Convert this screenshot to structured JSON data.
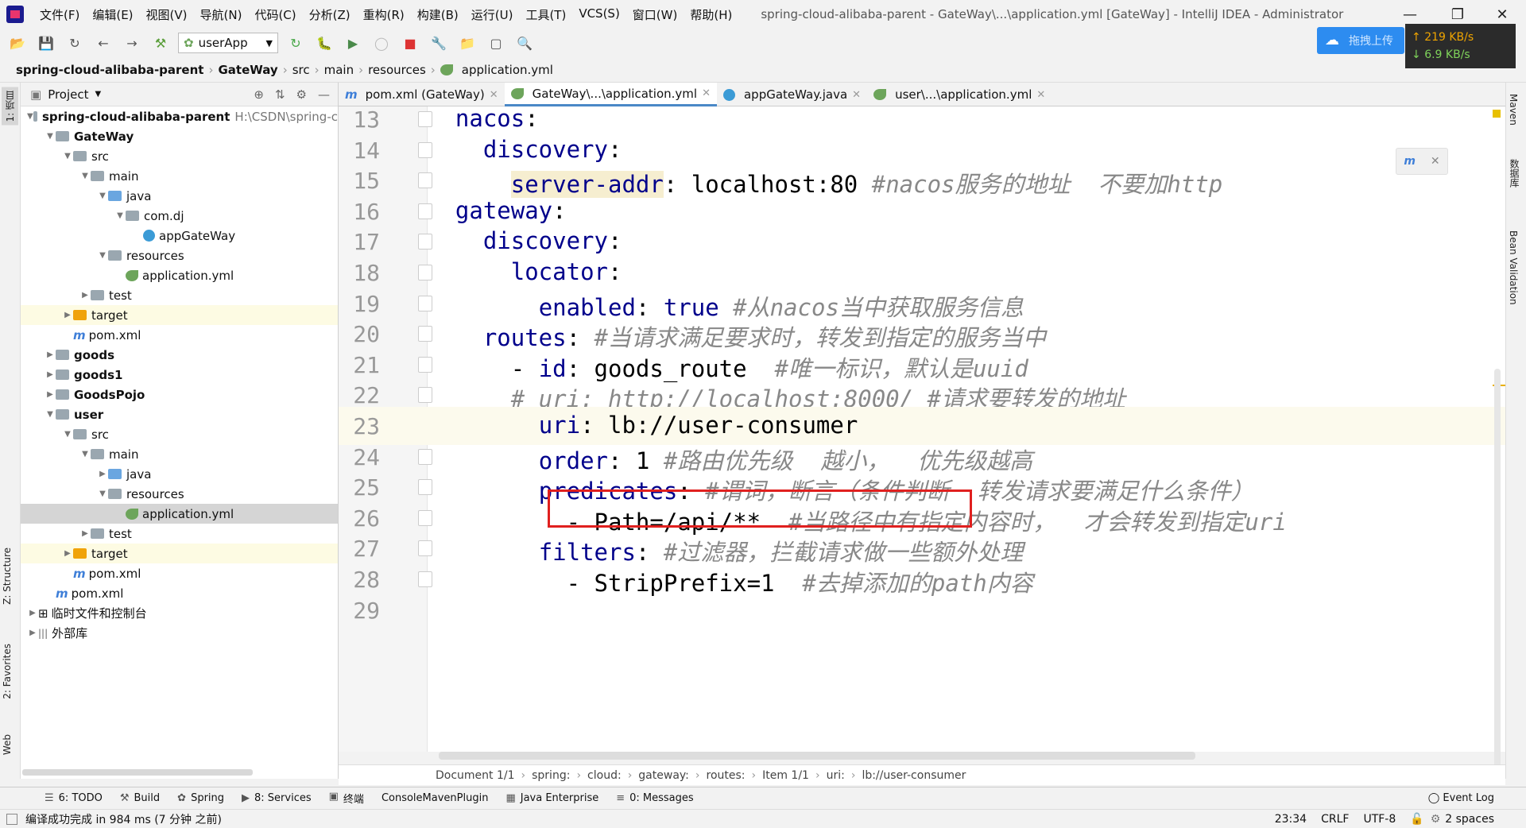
{
  "app": {
    "window_title": "spring-cloud-alibaba-parent - GateWay\\...\\application.yml [GateWay] - IntelliJ IDEA - Administrator",
    "menu": [
      "文件(F)",
      "编辑(E)",
      "视图(V)",
      "导航(N)",
      "代码(C)",
      "分析(Z)",
      "重构(R)",
      "构建(B)",
      "运行(U)",
      "工具(T)",
      "VCS(S)",
      "窗口(W)",
      "帮助(H)"
    ]
  },
  "toolbar": {
    "run_config": "userApp",
    "upload_label": "拖拽上传",
    "net_up": "219 KB/s",
    "net_down": "6.9 KB/s"
  },
  "breadcrumb": [
    "spring-cloud-alibaba-parent",
    "GateWay",
    "src",
    "main",
    "resources",
    "application.yml"
  ],
  "project": {
    "title": "Project",
    "root_path": "H:\\CSDN\\spring-c",
    "tree": [
      {
        "label": "spring-cloud-alibaba-parent",
        "depth": 0,
        "kind": "module",
        "bold": true,
        "open": true
      },
      {
        "label": "GateWay",
        "depth": 1,
        "kind": "module",
        "bold": true,
        "open": true
      },
      {
        "label": "src",
        "depth": 2,
        "kind": "folder",
        "open": true
      },
      {
        "label": "main",
        "depth": 3,
        "kind": "folder",
        "open": true
      },
      {
        "label": "java",
        "depth": 4,
        "kind": "blue",
        "open": true
      },
      {
        "label": "com.dj",
        "depth": 5,
        "kind": "folder",
        "open": true
      },
      {
        "label": "appGateWay",
        "depth": 6,
        "kind": "class"
      },
      {
        "label": "resources",
        "depth": 4,
        "kind": "res",
        "open": true
      },
      {
        "label": "application.yml",
        "depth": 5,
        "kind": "yml"
      },
      {
        "label": "test",
        "depth": 3,
        "kind": "folder",
        "open": false
      },
      {
        "label": "target",
        "depth": 2,
        "kind": "orange",
        "open": false,
        "hl": true
      },
      {
        "label": "pom.xml",
        "depth": 2,
        "kind": "maven"
      },
      {
        "label": "goods",
        "depth": 1,
        "kind": "module",
        "bold": true,
        "open": false
      },
      {
        "label": "goods1",
        "depth": 1,
        "kind": "module",
        "bold": true,
        "open": false
      },
      {
        "label": "GoodsPojo",
        "depth": 1,
        "kind": "module",
        "bold": true,
        "open": false
      },
      {
        "label": "user",
        "depth": 1,
        "kind": "module",
        "bold": true,
        "open": true
      },
      {
        "label": "src",
        "depth": 2,
        "kind": "folder",
        "open": true
      },
      {
        "label": "main",
        "depth": 3,
        "kind": "folder",
        "open": true
      },
      {
        "label": "java",
        "depth": 4,
        "kind": "blue",
        "open": false
      },
      {
        "label": "resources",
        "depth": 4,
        "kind": "res",
        "open": true
      },
      {
        "label": "application.yml",
        "depth": 5,
        "kind": "yml",
        "sel": true
      },
      {
        "label": "test",
        "depth": 3,
        "kind": "folder",
        "open": false
      },
      {
        "label": "target",
        "depth": 2,
        "kind": "orange",
        "open": false,
        "hl": true
      },
      {
        "label": "pom.xml",
        "depth": 2,
        "kind": "maven"
      },
      {
        "label": "pom.xml",
        "depth": 1,
        "kind": "maven"
      },
      {
        "label": "临时文件和控制台",
        "depth": 0,
        "kind": "scratch",
        "open": false
      },
      {
        "label": "外部库",
        "depth": 0,
        "kind": "lib",
        "open": false
      }
    ]
  },
  "tabs": [
    {
      "label": "pom.xml (GateWay)",
      "icon": "maven-icon"
    },
    {
      "label": "GateWay\\...\\application.yml",
      "icon": "yml-icon",
      "active": true
    },
    {
      "label": "appGateWay.java",
      "icon": "class-icon"
    },
    {
      "label": "user\\...\\application.yml",
      "icon": "yml-icon"
    }
  ],
  "editor": {
    "lines": [
      {
        "n": "13",
        "indent": "  ",
        "key": "nacos",
        "sep": ":",
        "val": "",
        "comment": ""
      },
      {
        "n": "14",
        "indent": "    ",
        "key": "discovery",
        "sep": ":",
        "val": "",
        "comment": ""
      },
      {
        "n": "15",
        "indent": "      ",
        "key": "server-addr",
        "sep": ":",
        "val": " localhost:80 ",
        "comment": "#nacos服务的地址  不要加http",
        "keyhl": true
      },
      {
        "n": "16",
        "indent": "  ",
        "key": "gateway",
        "sep": ":",
        "val": "",
        "comment": ""
      },
      {
        "n": "17",
        "indent": "    ",
        "key": "discovery",
        "sep": ":",
        "val": "",
        "comment": ""
      },
      {
        "n": "18",
        "indent": "      ",
        "key": "locator",
        "sep": ":",
        "val": "",
        "comment": ""
      },
      {
        "n": "19",
        "indent": "        ",
        "key": "enabled",
        "sep": ":",
        "val": " true ",
        "comment": "#从nacos当中获取服务信息",
        "valkw": true
      },
      {
        "n": "20",
        "indent": "    ",
        "key": "routes",
        "sep": ":",
        "val": " ",
        "comment": "#当请求满足要求时，转发到指定的服务当中"
      },
      {
        "n": "21",
        "indent": "      - ",
        "key": "id",
        "sep": ":",
        "val": " goods_route  ",
        "comment": "#唯一标识，默认是uuid"
      },
      {
        "n": "22",
        "indent": "      ",
        "key": "",
        "sep": "",
        "val": "",
        "comment": "# uri: http://localhost:8000/ #请求要转发的地址"
      },
      {
        "n": "23",
        "indent": "        ",
        "key": "uri",
        "sep": ":",
        "val": " lb://user-consumer",
        "comment": "",
        "cur": true
      },
      {
        "n": "24",
        "indent": "        ",
        "key": "order",
        "sep": ":",
        "val": " 1 ",
        "comment": "#路由优先级  越小，  优先级越高"
      },
      {
        "n": "25",
        "indent": "        ",
        "key": "predicates",
        "sep": ":",
        "val": " ",
        "comment": "#谓词，断言（条件判断  转发请求要满足什么条件）"
      },
      {
        "n": "26",
        "indent": "          - ",
        "key": "",
        "sep": "",
        "val": "Path=/api/**  ",
        "comment": "#当路径中有指定内容时，  才会转发到指定uri"
      },
      {
        "n": "27",
        "indent": "        ",
        "key": "filters",
        "sep": ":",
        "val": " ",
        "comment": "#过滤器，拦截请求做一些额外处理"
      },
      {
        "n": "28",
        "indent": "          - ",
        "key": "",
        "sep": "",
        "val": "StripPrefix=1  ",
        "comment": "#去掉添加的path内容"
      },
      {
        "n": "29",
        "indent": "",
        "key": "",
        "sep": "",
        "val": "",
        "comment": ""
      }
    ]
  },
  "editor_breadcrumb": [
    "Document 1/1",
    "spring:",
    "cloud:",
    "gateway:",
    "routes:",
    "Item 1/1",
    "uri:",
    "lb://user-consumer"
  ],
  "tool_windows": [
    "6: TODO",
    "Build",
    "Spring",
    "8: Services",
    "终端",
    "ConsoleMavenPlugin",
    "Java Enterprise",
    "0: Messages"
  ],
  "event_log": "Event Log",
  "left_strip": [
    "1: 项目",
    "Z: Structure",
    "2: Favorites",
    "Web"
  ],
  "right_strip": [
    "Maven",
    "数据库",
    "Bean Validation"
  ],
  "status": {
    "message": "编译成功完成 in 984 ms (7 分钟 之前)",
    "position": "23:34",
    "line_sep": "CRLF",
    "encoding": "UTF-8",
    "indent": "2 spaces"
  }
}
